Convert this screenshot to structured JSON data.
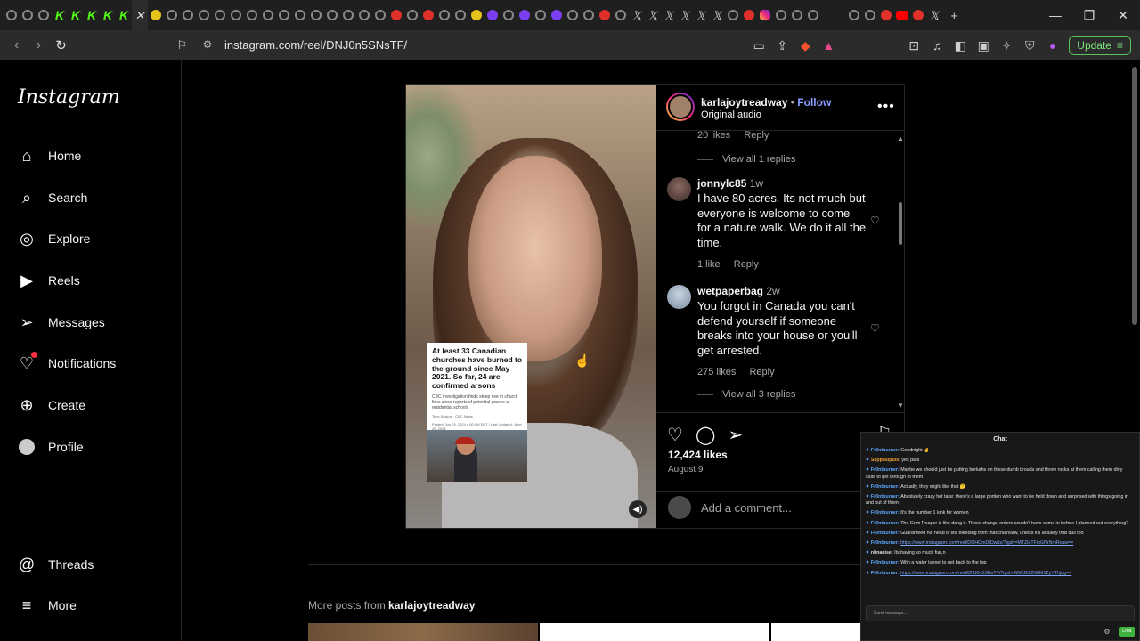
{
  "browser": {
    "url": "instagram.com/reel/DNJ0n5SNsTF/",
    "update_label": "Update",
    "window_controls": [
      "—",
      "❐",
      "✕"
    ]
  },
  "sidebar": {
    "logo": "Instagram",
    "items": [
      {
        "label": "Home",
        "icon": "home-icon"
      },
      {
        "label": "Search",
        "icon": "search-icon"
      },
      {
        "label": "Explore",
        "icon": "compass-icon"
      },
      {
        "label": "Reels",
        "icon": "reels-icon"
      },
      {
        "label": "Messages",
        "icon": "send-icon"
      },
      {
        "label": "Notifications",
        "icon": "heart-icon"
      },
      {
        "label": "Create",
        "icon": "plus-icon"
      },
      {
        "label": "Profile",
        "icon": "avatar-icon"
      },
      {
        "label": "Threads",
        "icon": "threads-icon"
      },
      {
        "label": "More",
        "icon": "menu-icon"
      }
    ]
  },
  "post": {
    "username": "karlajoytreadway",
    "follow_label": "Follow",
    "audio": "Original audio",
    "news_card": {
      "headline": "At least 33 Canadian churches have burned to the ground since May 2021. So far, 24 are confirmed arsons",
      "subhead": "CBC investigation finds steep rise in church fires since reports of potential graves at residential schools",
      "byline": "Tony Seskus · CBC News",
      "posted": "Posted: Jun 29, 2024 4:00 AM EDT | Last Updated: June 29, 2024"
    },
    "top_meta": {
      "likes": "20 likes",
      "reply": "Reply"
    },
    "view_replies_1": "View all 1 replies",
    "comments": [
      {
        "user": "jonnylc85",
        "when": "1w",
        "text": "I have 80 acres. Its not much but everyone is welcome to come for a nature walk. We do it all the time.",
        "likes": "1 like",
        "reply": "Reply"
      },
      {
        "user": "wetpaperbag",
        "when": "2w",
        "text": "You forgot in Canada you can't defend yourself if someone breaks into your house or you'll get arrested.",
        "likes": "275 likes",
        "reply": "Reply"
      }
    ],
    "view_replies_3": "View all 3 replies",
    "likes_total": "12,424 likes",
    "date": "August 9",
    "add_comment_placeholder": "Add a comment..."
  },
  "more_posts": {
    "prefix": "More posts from",
    "user": "karlajoytreadway"
  },
  "chat": {
    "title": "Chat",
    "messages": [
      {
        "user": "Fr0ntburner",
        "color": "#5da8ff",
        "text": "Goodnight ✌"
      },
      {
        "user": "Slippaslpuls",
        "color": "#f3a43a",
        "text": "yes papi"
      },
      {
        "user": "Fr0ntburner",
        "color": "#5da8ff",
        "text": "Maybe we should just be putting burkahs on these dumb broads and throw rocks at them calling them dirty sluts to get through to them"
      },
      {
        "user": "Fr0ntburner",
        "color": "#5da8ff",
        "text": "Actually, they might like that 🤔"
      },
      {
        "user": "Fr0ntburner",
        "color": "#5da8ff",
        "text": "Absolutely crazy hot take: there's a large portion who want to be held down and surprised with things going in and out of them"
      },
      {
        "user": "Fr0ntburner",
        "color": "#5da8ff",
        "text": "It's the number 1 kink for women"
      },
      {
        "user": "Fr0ntburner",
        "color": "#5da8ff",
        "text": "The Grim Reaper is like dang it. These change orders couldn't have come in before I planned out everything?"
      },
      {
        "user": "Fr0ntburner",
        "color": "#5da8ff",
        "text": "Guaranteed his head is still bleeding from that chainsaw, unless it's actually that dull too"
      },
      {
        "user": "Fr0ntburner",
        "color": "#5da8ff",
        "link": "https://www.instagram.com/reel/DOHOmDIDwdz/?igsh=MTZlaTFibGNrNmRvaw=="
      },
      {
        "user": "nlinanise",
        "color": "#dddddd",
        "text": "Its having so much fun,n"
      },
      {
        "user": "Fr0ntburner",
        "color": "#5da8ff",
        "text": "With a water tunnel to get back to the top"
      },
      {
        "user": "Fr0ntburner",
        "color": "#5da8ff",
        "link": "https://www.instagram.com/reel/DNJ0n5SNsTF/?igsh=MWJ2Z2N0M3ZyYThjdg=="
      }
    ],
    "input_placeholder": "Send message...",
    "send_label": "Chat"
  }
}
